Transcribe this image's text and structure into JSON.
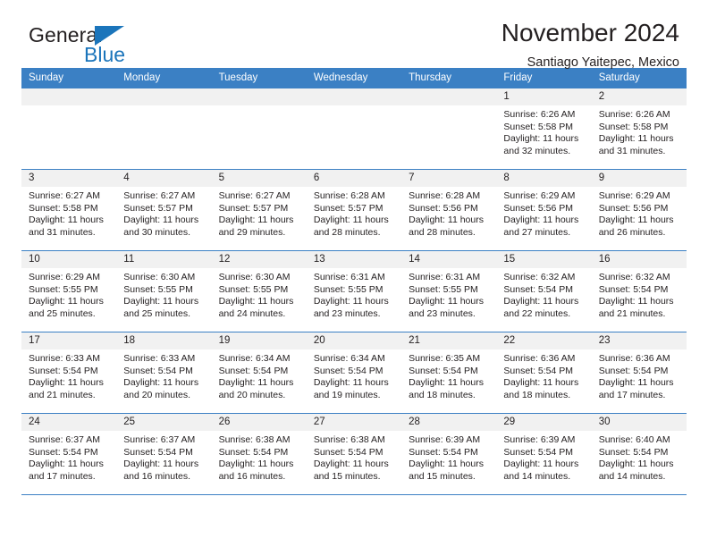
{
  "brand": {
    "name_part1": "General",
    "name_part2": "Blue",
    "triangle_color": "#1b75bb"
  },
  "header": {
    "title": "November 2024",
    "subtitle": "Santiago Yaitepec, Mexico",
    "accent_color": "#3b80c4",
    "daynum_bg": "#f1f1f1"
  },
  "weekdays": [
    "Sunday",
    "Monday",
    "Tuesday",
    "Wednesday",
    "Thursday",
    "Friday",
    "Saturday"
  ],
  "weeks": [
    [
      {
        "day": "",
        "sunrise": "",
        "sunset": "",
        "daylight": ""
      },
      {
        "day": "",
        "sunrise": "",
        "sunset": "",
        "daylight": ""
      },
      {
        "day": "",
        "sunrise": "",
        "sunset": "",
        "daylight": ""
      },
      {
        "day": "",
        "sunrise": "",
        "sunset": "",
        "daylight": ""
      },
      {
        "day": "",
        "sunrise": "",
        "sunset": "",
        "daylight": ""
      },
      {
        "day": "1",
        "sunrise": "Sunrise: 6:26 AM",
        "sunset": "Sunset: 5:58 PM",
        "daylight": "Daylight: 11 hours and 32 minutes."
      },
      {
        "day": "2",
        "sunrise": "Sunrise: 6:26 AM",
        "sunset": "Sunset: 5:58 PM",
        "daylight": "Daylight: 11 hours and 31 minutes."
      }
    ],
    [
      {
        "day": "3",
        "sunrise": "Sunrise: 6:27 AM",
        "sunset": "Sunset: 5:58 PM",
        "daylight": "Daylight: 11 hours and 31 minutes."
      },
      {
        "day": "4",
        "sunrise": "Sunrise: 6:27 AM",
        "sunset": "Sunset: 5:57 PM",
        "daylight": "Daylight: 11 hours and 30 minutes."
      },
      {
        "day": "5",
        "sunrise": "Sunrise: 6:27 AM",
        "sunset": "Sunset: 5:57 PM",
        "daylight": "Daylight: 11 hours and 29 minutes."
      },
      {
        "day": "6",
        "sunrise": "Sunrise: 6:28 AM",
        "sunset": "Sunset: 5:57 PM",
        "daylight": "Daylight: 11 hours and 28 minutes."
      },
      {
        "day": "7",
        "sunrise": "Sunrise: 6:28 AM",
        "sunset": "Sunset: 5:56 PM",
        "daylight": "Daylight: 11 hours and 28 minutes."
      },
      {
        "day": "8",
        "sunrise": "Sunrise: 6:29 AM",
        "sunset": "Sunset: 5:56 PM",
        "daylight": "Daylight: 11 hours and 27 minutes."
      },
      {
        "day": "9",
        "sunrise": "Sunrise: 6:29 AM",
        "sunset": "Sunset: 5:56 PM",
        "daylight": "Daylight: 11 hours and 26 minutes."
      }
    ],
    [
      {
        "day": "10",
        "sunrise": "Sunrise: 6:29 AM",
        "sunset": "Sunset: 5:55 PM",
        "daylight": "Daylight: 11 hours and 25 minutes."
      },
      {
        "day": "11",
        "sunrise": "Sunrise: 6:30 AM",
        "sunset": "Sunset: 5:55 PM",
        "daylight": "Daylight: 11 hours and 25 minutes."
      },
      {
        "day": "12",
        "sunrise": "Sunrise: 6:30 AM",
        "sunset": "Sunset: 5:55 PM",
        "daylight": "Daylight: 11 hours and 24 minutes."
      },
      {
        "day": "13",
        "sunrise": "Sunrise: 6:31 AM",
        "sunset": "Sunset: 5:55 PM",
        "daylight": "Daylight: 11 hours and 23 minutes."
      },
      {
        "day": "14",
        "sunrise": "Sunrise: 6:31 AM",
        "sunset": "Sunset: 5:55 PM",
        "daylight": "Daylight: 11 hours and 23 minutes."
      },
      {
        "day": "15",
        "sunrise": "Sunrise: 6:32 AM",
        "sunset": "Sunset: 5:54 PM",
        "daylight": "Daylight: 11 hours and 22 minutes."
      },
      {
        "day": "16",
        "sunrise": "Sunrise: 6:32 AM",
        "sunset": "Sunset: 5:54 PM",
        "daylight": "Daylight: 11 hours and 21 minutes."
      }
    ],
    [
      {
        "day": "17",
        "sunrise": "Sunrise: 6:33 AM",
        "sunset": "Sunset: 5:54 PM",
        "daylight": "Daylight: 11 hours and 21 minutes."
      },
      {
        "day": "18",
        "sunrise": "Sunrise: 6:33 AM",
        "sunset": "Sunset: 5:54 PM",
        "daylight": "Daylight: 11 hours and 20 minutes."
      },
      {
        "day": "19",
        "sunrise": "Sunrise: 6:34 AM",
        "sunset": "Sunset: 5:54 PM",
        "daylight": "Daylight: 11 hours and 20 minutes."
      },
      {
        "day": "20",
        "sunrise": "Sunrise: 6:34 AM",
        "sunset": "Sunset: 5:54 PM",
        "daylight": "Daylight: 11 hours and 19 minutes."
      },
      {
        "day": "21",
        "sunrise": "Sunrise: 6:35 AM",
        "sunset": "Sunset: 5:54 PM",
        "daylight": "Daylight: 11 hours and 18 minutes."
      },
      {
        "day": "22",
        "sunrise": "Sunrise: 6:36 AM",
        "sunset": "Sunset: 5:54 PM",
        "daylight": "Daylight: 11 hours and 18 minutes."
      },
      {
        "day": "23",
        "sunrise": "Sunrise: 6:36 AM",
        "sunset": "Sunset: 5:54 PM",
        "daylight": "Daylight: 11 hours and 17 minutes."
      }
    ],
    [
      {
        "day": "24",
        "sunrise": "Sunrise: 6:37 AM",
        "sunset": "Sunset: 5:54 PM",
        "daylight": "Daylight: 11 hours and 17 minutes."
      },
      {
        "day": "25",
        "sunrise": "Sunrise: 6:37 AM",
        "sunset": "Sunset: 5:54 PM",
        "daylight": "Daylight: 11 hours and 16 minutes."
      },
      {
        "day": "26",
        "sunrise": "Sunrise: 6:38 AM",
        "sunset": "Sunset: 5:54 PM",
        "daylight": "Daylight: 11 hours and 16 minutes."
      },
      {
        "day": "27",
        "sunrise": "Sunrise: 6:38 AM",
        "sunset": "Sunset: 5:54 PM",
        "daylight": "Daylight: 11 hours and 15 minutes."
      },
      {
        "day": "28",
        "sunrise": "Sunrise: 6:39 AM",
        "sunset": "Sunset: 5:54 PM",
        "daylight": "Daylight: 11 hours and 15 minutes."
      },
      {
        "day": "29",
        "sunrise": "Sunrise: 6:39 AM",
        "sunset": "Sunset: 5:54 PM",
        "daylight": "Daylight: 11 hours and 14 minutes."
      },
      {
        "day": "30",
        "sunrise": "Sunrise: 6:40 AM",
        "sunset": "Sunset: 5:54 PM",
        "daylight": "Daylight: 11 hours and 14 minutes."
      }
    ]
  ]
}
